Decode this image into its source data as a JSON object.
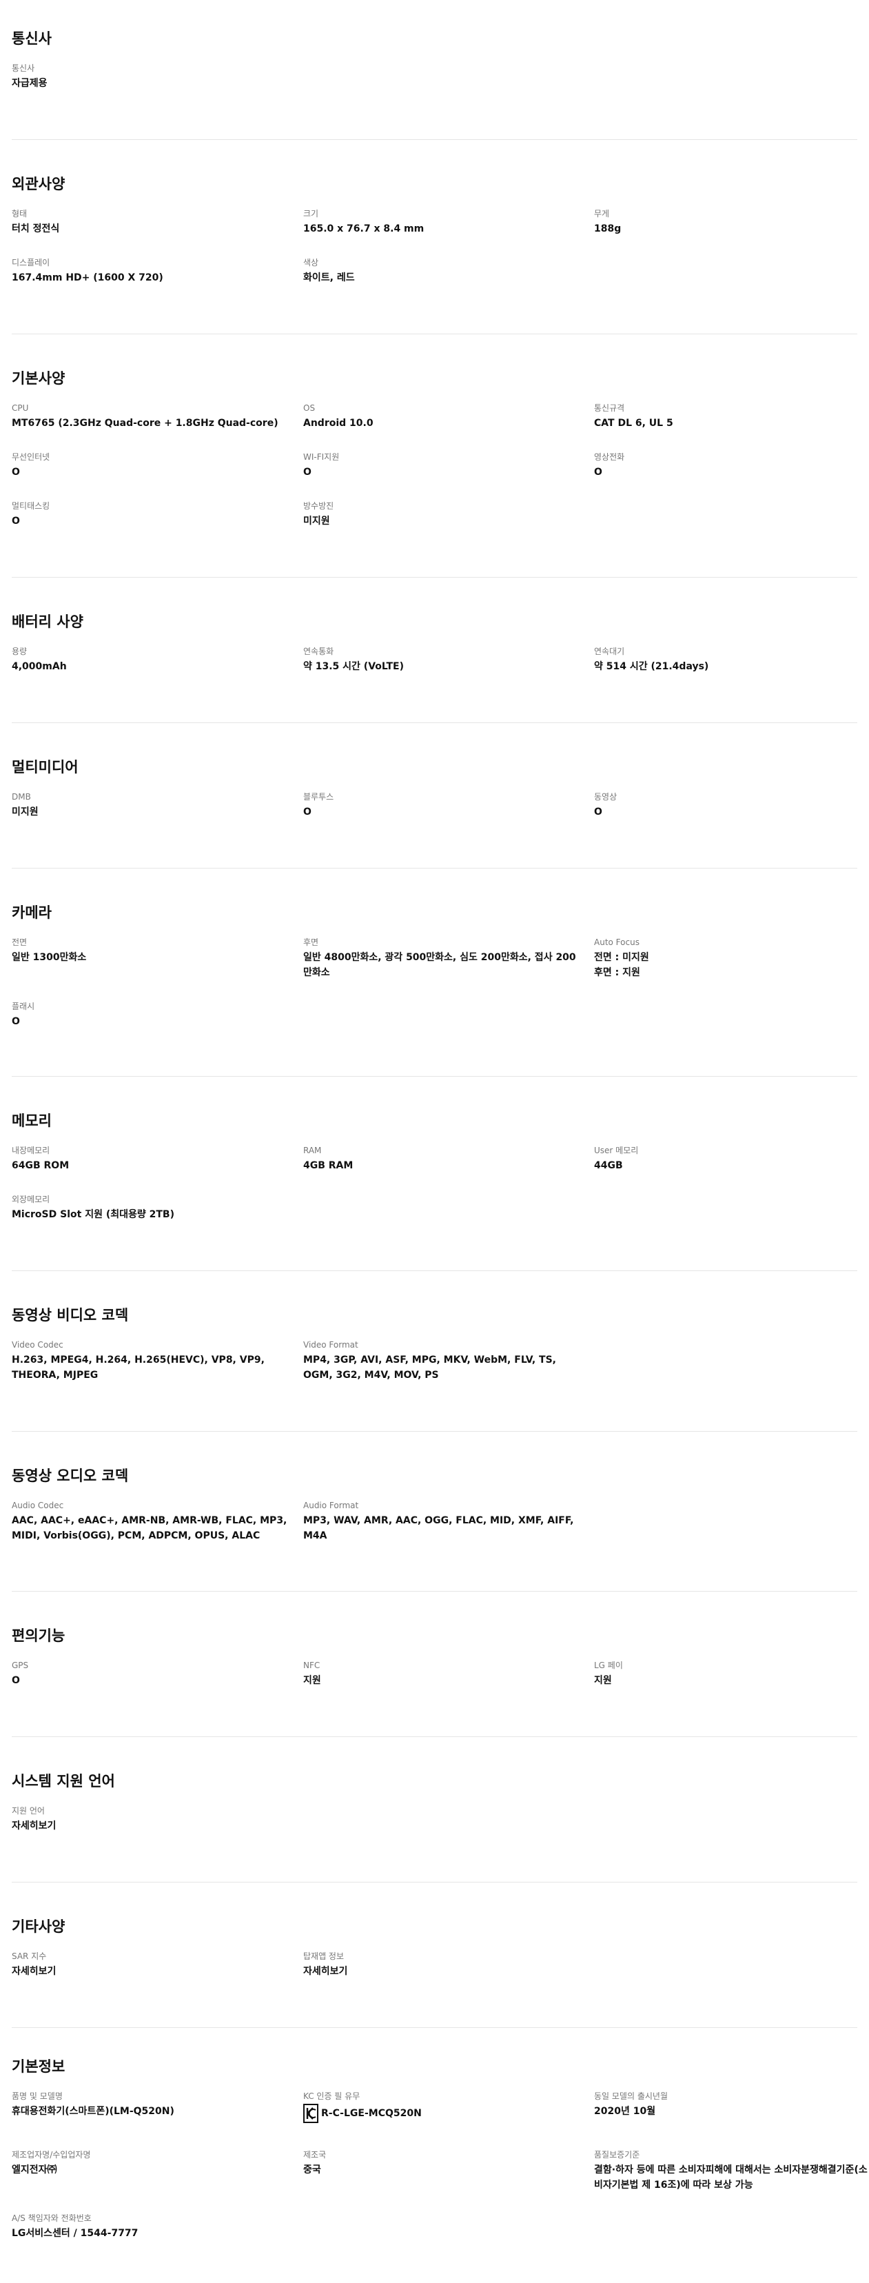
{
  "sections": [
    {
      "title": "통신사",
      "specs": [
        {
          "label": "통신사",
          "value": "자급제용"
        }
      ]
    },
    {
      "title": "외관사양",
      "specs": [
        {
          "label": "형태",
          "value": "터치 정전식"
        },
        {
          "label": "크기",
          "value": "165.0 x 76.7 x 8.4 mm"
        },
        {
          "label": "무게",
          "value": "188g"
        },
        {
          "label": "디스플레이",
          "value": "167.4mm HD+ (1600 X 720)"
        },
        {
          "label": "색상",
          "value": "화이트, 레드"
        }
      ]
    },
    {
      "title": "기본사양",
      "specs": [
        {
          "label": "CPU",
          "value": "MT6765 (2.3GHz Quad-core + 1.8GHz Quad-core)"
        },
        {
          "label": "OS",
          "value": "Android 10.0"
        },
        {
          "label": "통신규격",
          "value": "CAT DL 6, UL 5"
        },
        {
          "label": "무선인터넷",
          "value": "O"
        },
        {
          "label": "WI-FI지원",
          "value": "O"
        },
        {
          "label": "영상전화",
          "value": "O"
        },
        {
          "label": "멀티태스킹",
          "value": "O"
        },
        {
          "label": "방수방진",
          "value": "미지원"
        }
      ]
    },
    {
      "title": "배터리 사양",
      "specs": [
        {
          "label": "용량",
          "value": "4,000mAh"
        },
        {
          "label": "연속통화",
          "value": "약 13.5 시간 (VoLTE)"
        },
        {
          "label": "연속대기",
          "value": "약 514 시간 (21.4days)"
        }
      ]
    },
    {
      "title": "멀티미디어",
      "specs": [
        {
          "label": "DMB",
          "value": "미지원"
        },
        {
          "label": "블루투스",
          "value": "O"
        },
        {
          "label": "동영상",
          "value": "O"
        }
      ]
    },
    {
      "title": "카메라",
      "specs": [
        {
          "label": "전면",
          "value": "일반 1300만화소"
        },
        {
          "label": "후면",
          "value": "일반 4800만화소, 광각 500만화소, 심도 200만화소, 접사 200만화소"
        },
        {
          "label": "Auto Focus",
          "value": "전면 : 미지원\n후면 : 지원"
        },
        {
          "label": "플래시",
          "value": "O"
        }
      ]
    },
    {
      "title": "메모리",
      "specs": [
        {
          "label": "내장메모리",
          "value": "64GB ROM"
        },
        {
          "label": "RAM",
          "value": "4GB RAM"
        },
        {
          "label": "User 메모리",
          "value": "44GB"
        },
        {
          "label": "외장메모리",
          "value": "MicroSD Slot 지원 (최대용량 2TB)"
        }
      ]
    },
    {
      "title": "동영상 비디오 코덱",
      "specs": [
        {
          "label": "Video Codec",
          "value": "H.263, MPEG4, H.264, H.265(HEVC), VP8, VP9, THEORA, MJPEG"
        },
        {
          "label": "Video Format",
          "value": "MP4, 3GP, AVI, ASF, MPG, MKV, WebM, FLV, TS, OGM, 3G2, M4V, MOV, PS"
        }
      ]
    },
    {
      "title": "동영상 오디오 코덱",
      "specs": [
        {
          "label": "Audio Codec",
          "value": "AAC, AAC+, eAAC+, AMR-NB, AMR-WB, FLAC, MP3, MIDI, Vorbis(OGG), PCM, ADPCM, OPUS, ALAC"
        },
        {
          "label": "Audio Format",
          "value": "MP3, WAV, AMR, AAC, OGG, FLAC, MID, XMF, AIFF, M4A"
        }
      ]
    },
    {
      "title": "편의기능",
      "specs": [
        {
          "label": "GPS",
          "value": "O"
        },
        {
          "label": "NFC",
          "value": "지원"
        },
        {
          "label": "LG 페이",
          "value": "지원"
        }
      ]
    },
    {
      "title": "시스템 지원 언어",
      "specs": [
        {
          "label": "지원 언어",
          "value": "자세히보기"
        }
      ]
    },
    {
      "title": "기타사양",
      "specs": [
        {
          "label": "SAR 지수",
          "value": "자세히보기"
        },
        {
          "label": "탑재앱 정보",
          "value": "자세히보기"
        }
      ]
    },
    {
      "title": "기본정보",
      "specs": [
        {
          "label": "품명 및 모델명",
          "value": "휴대용전화기(스마트폰)(LM-Q520N)"
        },
        {
          "label": "KC 인증 필 유무",
          "value": "R-C-LGE-MCQ520N",
          "icon": "kc-mark-icon"
        },
        {
          "label": "동일 모델의 출시년월",
          "value": "2020년 10월"
        },
        {
          "label": "제조업자명/수입업자명",
          "value": "엘지전자㈜"
        },
        {
          "label": "제조국",
          "value": "중국"
        },
        {
          "label": "품질보증기준",
          "value": "결함·하자 등에 따른 소비자피해에 대해서는 소비자분쟁해결기준(소비자기본법 제 16조)에 따라 보상 가능"
        },
        {
          "label": "A/S 책임자와 전화번호",
          "value": "LG서비스센터 / 1544-7777"
        }
      ]
    }
  ]
}
